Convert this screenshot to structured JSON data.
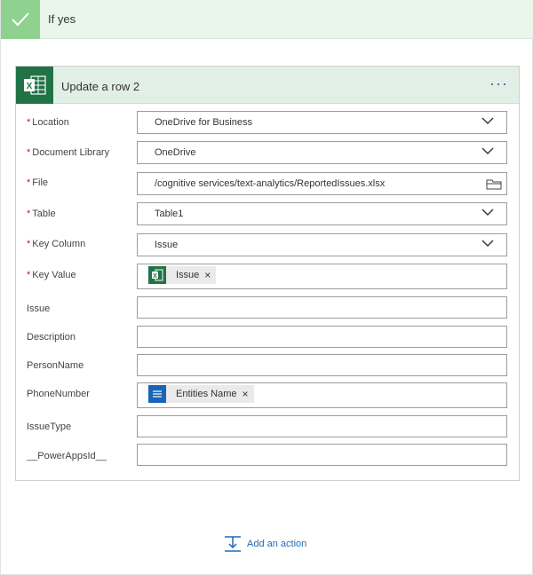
{
  "branch": {
    "title": "If yes",
    "accent_color": "#8fd18f",
    "check_icon": "checkmark-icon"
  },
  "card": {
    "title": "Update a row 2",
    "icon": "excel-icon",
    "more_label": "···",
    "fields": [
      {
        "label": "Location",
        "required": true,
        "value": "OneDrive for Business",
        "kind": "dropdown"
      },
      {
        "label": "Document Library",
        "required": true,
        "value": "OneDrive",
        "kind": "dropdown"
      },
      {
        "label": "File",
        "required": true,
        "value": "/cognitive services/text-analytics/ReportedIssues.xlsx",
        "kind": "file"
      },
      {
        "label": "Table",
        "required": true,
        "value": "Table1",
        "kind": "dropdown"
      },
      {
        "label": "Key Column",
        "required": true,
        "value": "Issue",
        "kind": "dropdown"
      },
      {
        "label": "Key Value",
        "required": true,
        "token": "Issue",
        "token_icon": "excel-icon",
        "kind": "token"
      },
      {
        "label": "Issue",
        "required": false,
        "value": "",
        "kind": "text"
      },
      {
        "label": "Description",
        "required": false,
        "value": "",
        "kind": "text"
      },
      {
        "label": "PersonName",
        "required": false,
        "value": "",
        "kind": "text"
      },
      {
        "label": "PhoneNumber",
        "required": false,
        "token": "Entities Name",
        "token_icon": "list-icon",
        "kind": "token"
      },
      {
        "label": "IssueType",
        "required": false,
        "value": "",
        "kind": "text"
      },
      {
        "label": "__PowerAppsId__",
        "required": false,
        "value": "",
        "kind": "text"
      }
    ]
  },
  "add_action": {
    "label": "Add an action",
    "icon": "insert-action-icon"
  },
  "colors": {
    "excel_green": "#217346",
    "link_blue": "#1f6bb5",
    "required_red": "#c41e1e"
  }
}
